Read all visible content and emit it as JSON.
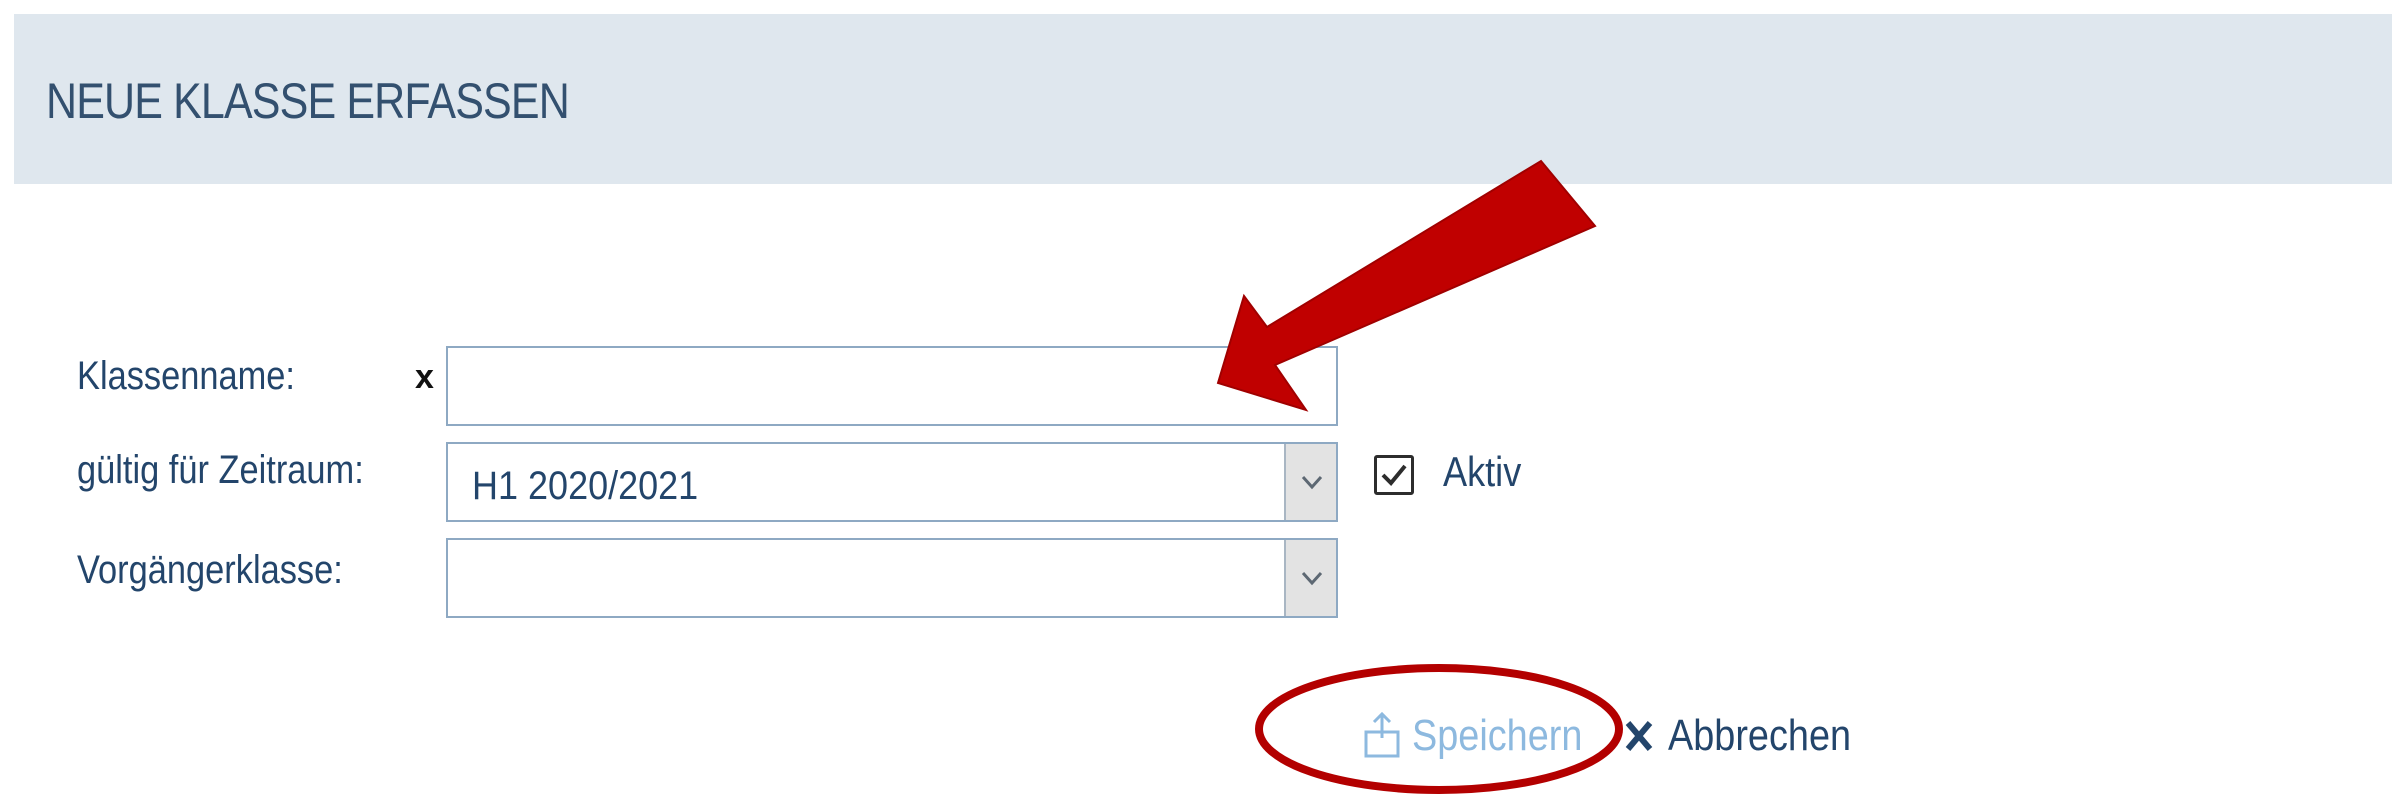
{
  "header": {
    "title": "NEUE KLASSE ERFASSEN"
  },
  "form": {
    "class_name_label": "Klassenname:",
    "required_mark": "x",
    "class_name_value": "",
    "period_label": "gültig für Zeitraum:",
    "period_value": "H1 2020/2021",
    "active_label": "Aktiv",
    "active_checked": true,
    "predecessor_label": "Vorgängerklasse:",
    "predecessor_value": ""
  },
  "actions": {
    "save_label": "Speichern",
    "cancel_label": "Abbrechen"
  },
  "icons": {
    "save": "save-icon",
    "cancel": "close-icon",
    "dropdown": "chevron-down-icon",
    "checkbox": "checkmark-icon"
  },
  "colors": {
    "header_bg": "#dfe7ee",
    "text": "#23456b",
    "save_disabled": "#8db9df",
    "annotation": "#c00000"
  }
}
